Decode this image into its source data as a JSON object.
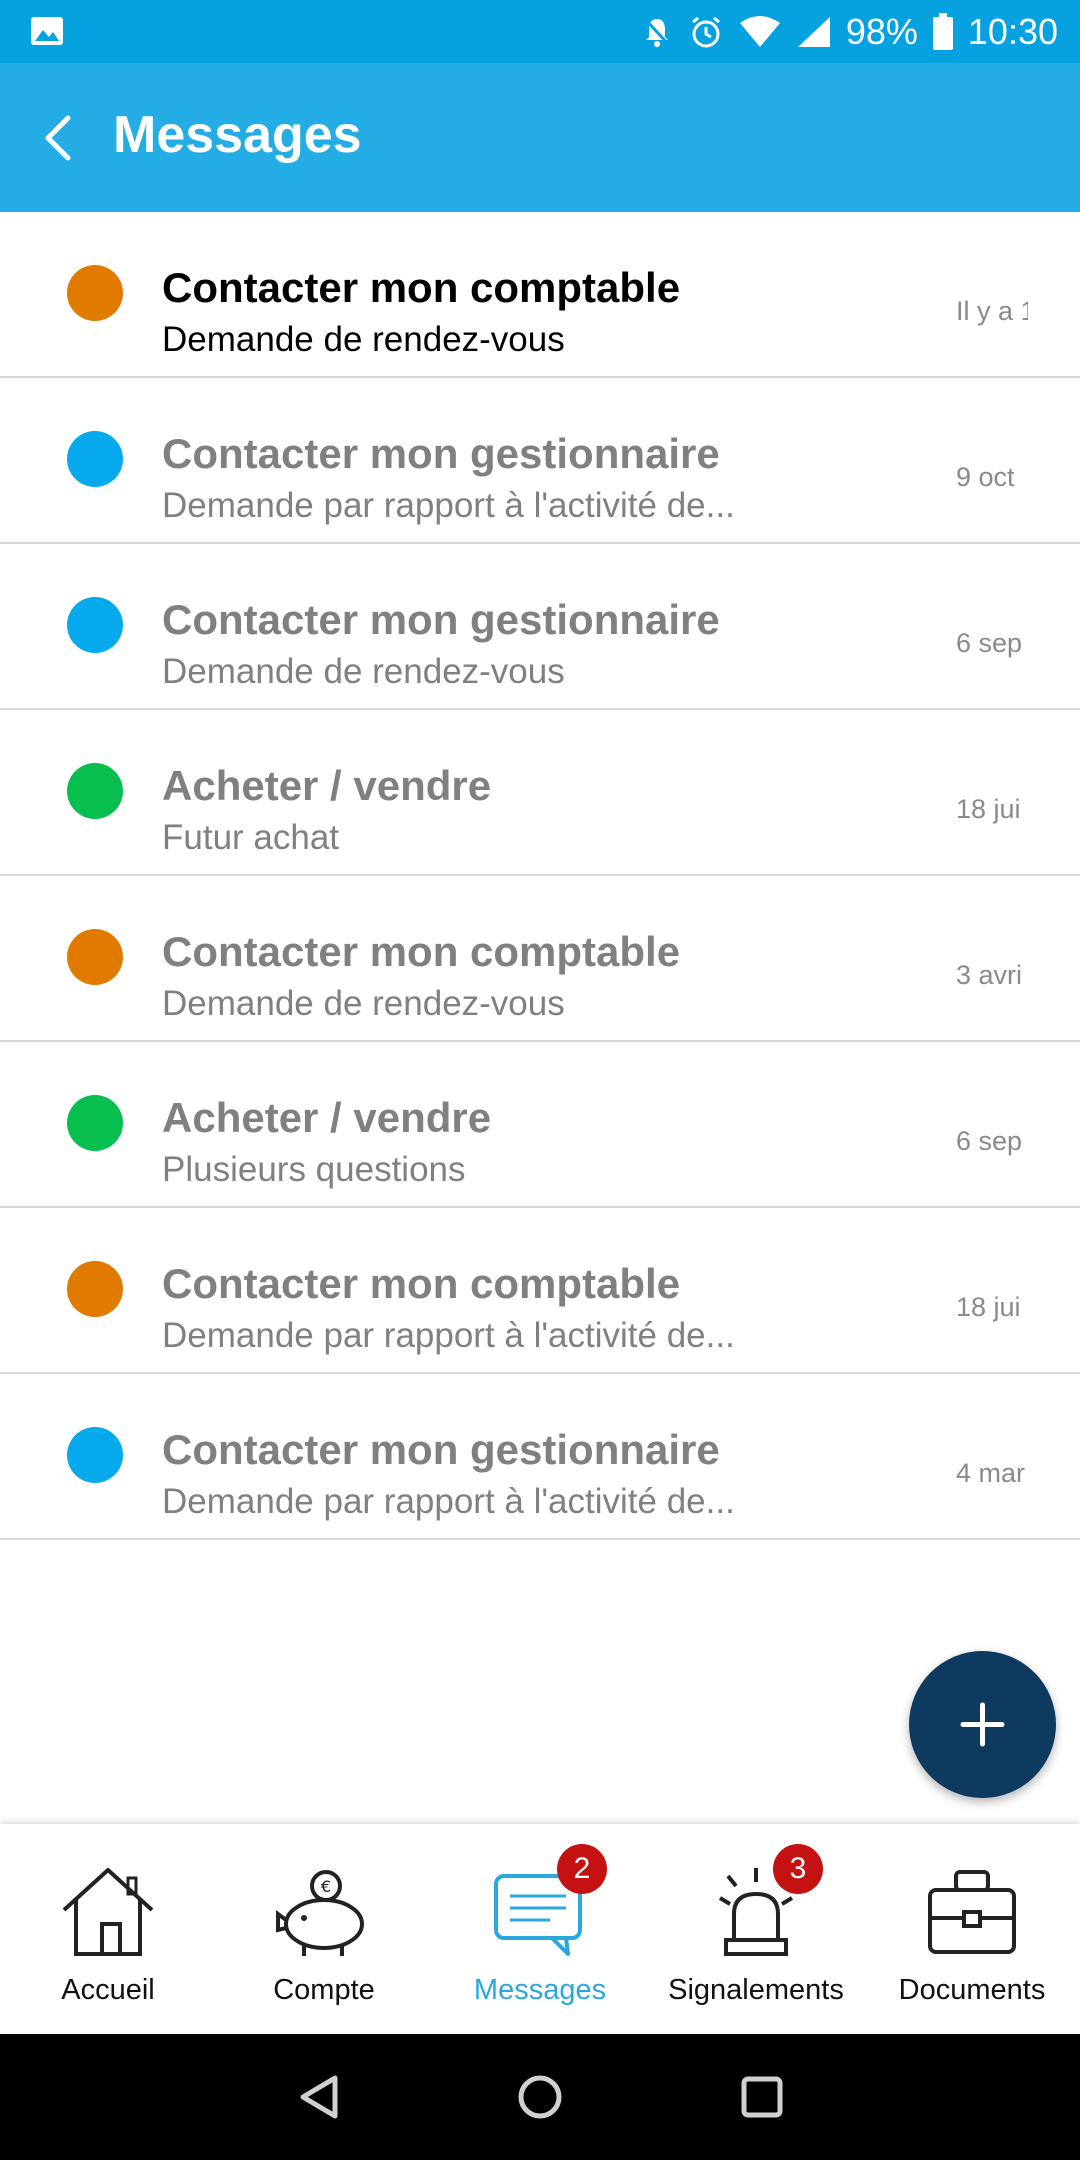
{
  "status_bar": {
    "battery": "98%",
    "time": "10:30",
    "icons": [
      "image-icon",
      "bell-off-icon",
      "alarm-icon",
      "wifi-icon",
      "signal-icon",
      "battery-icon"
    ]
  },
  "header": {
    "title": "Messages",
    "back_icon": "chevron-left-icon"
  },
  "messages": [
    {
      "title": "Contacter mon comptable",
      "subtitle": "Demande de rendez-vous",
      "date": "Il y a 1",
      "color": "#e07b00",
      "unread": true
    },
    {
      "title": "Contacter mon gestionnaire",
      "subtitle": "Demande par rapport à l'activité de...",
      "date": "9 oct",
      "color": "#05a9ec",
      "unread": false
    },
    {
      "title": "Contacter mon gestionnaire",
      "subtitle": "Demande de rendez-vous",
      "date": "6 sep",
      "color": "#05a9ec",
      "unread": false
    },
    {
      "title": "Acheter / vendre",
      "subtitle": "Futur achat",
      "date": "18 jui",
      "color": "#08be4f",
      "unread": false
    },
    {
      "title": "Contacter mon comptable",
      "subtitle": "Demande de rendez-vous",
      "date": "3 avri",
      "color": "#e07b00",
      "unread": false
    },
    {
      "title": "Acheter / vendre",
      "subtitle": "Plusieurs questions",
      "date": "6 sep",
      "color": "#08be4f",
      "unread": false
    },
    {
      "title": "Contacter mon comptable",
      "subtitle": "Demande par rapport à l'activité de...",
      "date": "18 jui",
      "color": "#e07b00",
      "unread": false
    },
    {
      "title": "Contacter mon gestionnaire",
      "subtitle": "Demande par rapport à l'activité de...",
      "date": "4 mar",
      "color": "#05a9ec",
      "unread": false
    }
  ],
  "fab": {
    "icon": "plus-icon",
    "color": "#0e3a5f"
  },
  "bottom_nav": {
    "accent": "#2aa8de",
    "items": [
      {
        "label": "Accueil",
        "icon": "home-icon",
        "active": false,
        "badge": null
      },
      {
        "label": "Compte",
        "icon": "piggy-bank-icon",
        "active": false,
        "badge": null
      },
      {
        "label": "Messages",
        "icon": "chat-icon",
        "active": true,
        "badge": "2"
      },
      {
        "label": "Signalements",
        "icon": "siren-icon",
        "active": false,
        "badge": "3"
      },
      {
        "label": "Documents",
        "icon": "briefcase-icon",
        "active": false,
        "badge": null
      }
    ]
  },
  "system_nav": [
    "back-triangle-icon",
    "home-circle-icon",
    "recents-square-icon"
  ]
}
